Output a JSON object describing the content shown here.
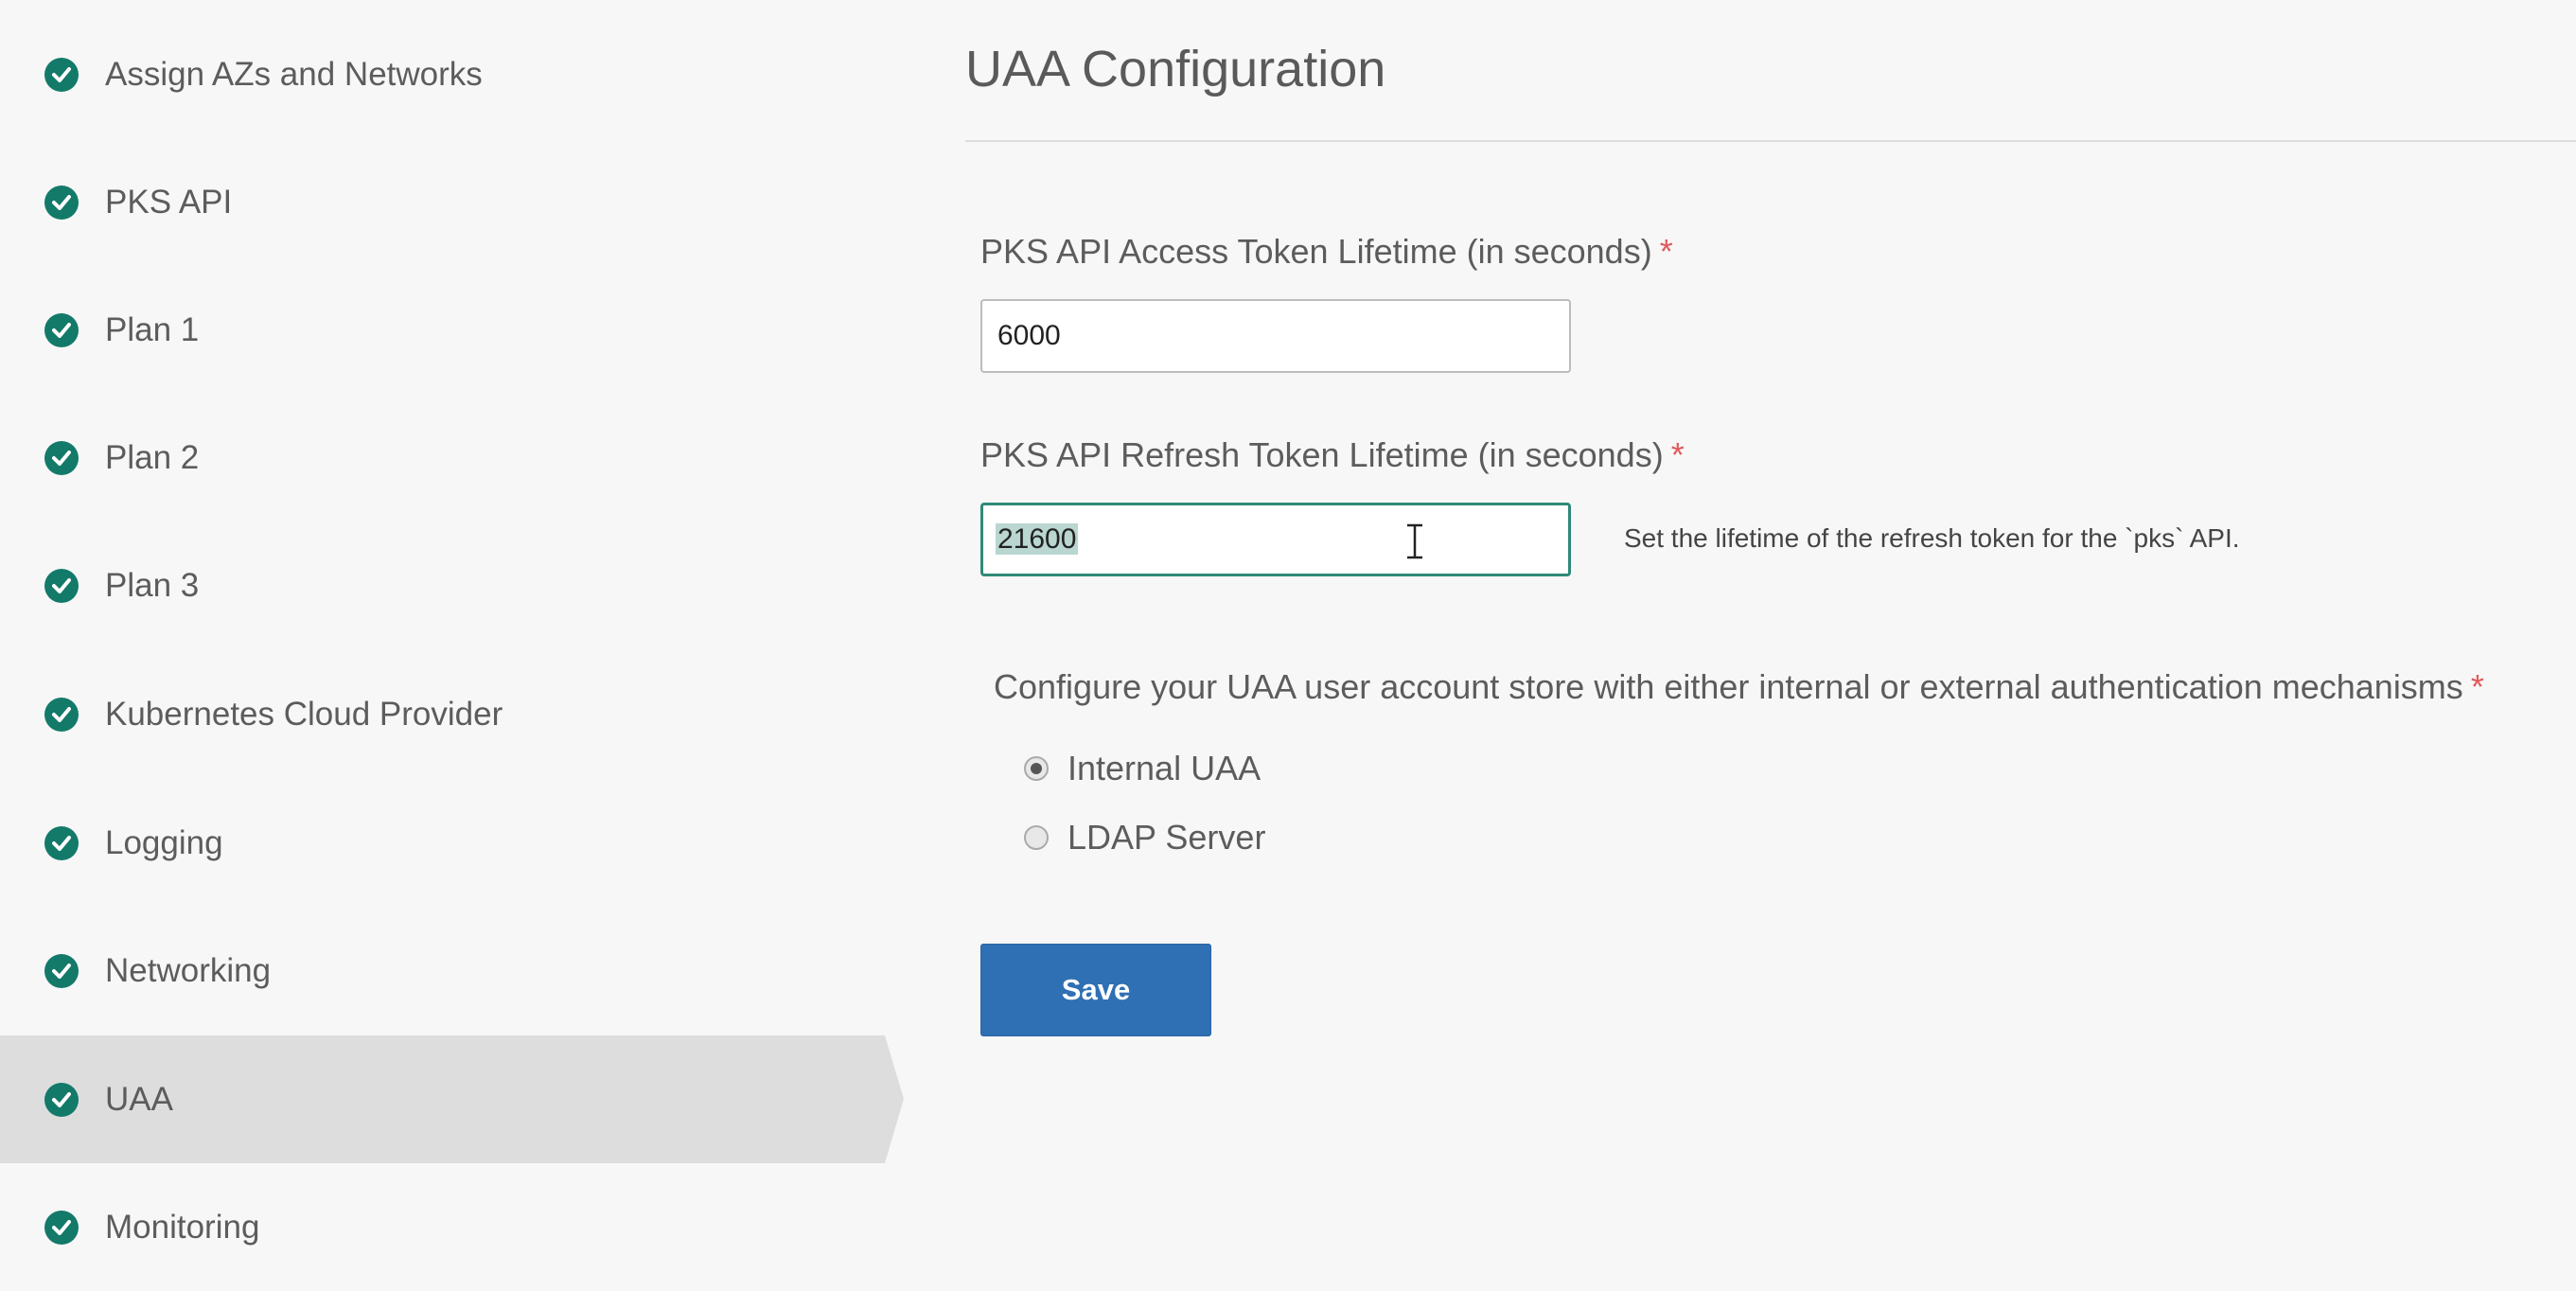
{
  "sidebar": {
    "items": [
      {
        "label": "Assign AZs and Networks",
        "status_icon": "check-circle-icon"
      },
      {
        "label": "PKS API",
        "status_icon": "check-circle-icon"
      },
      {
        "label": "Plan 1",
        "status_icon": "check-circle-icon"
      },
      {
        "label": "Plan 2",
        "status_icon": "check-circle-icon"
      },
      {
        "label": "Plan 3",
        "status_icon": "check-circle-icon"
      },
      {
        "label": "Kubernetes Cloud Provider",
        "status_icon": "check-circle-icon"
      },
      {
        "label": "Logging",
        "status_icon": "check-circle-icon"
      },
      {
        "label": "Networking",
        "status_icon": "check-circle-icon"
      },
      {
        "label": "UAA",
        "status_icon": "check-circle-icon",
        "active": true
      },
      {
        "label": "Monitoring",
        "status_icon": "check-circle-icon"
      }
    ]
  },
  "main": {
    "title": "UAA Configuration",
    "access_token": {
      "label": "PKS API Access Token Lifetime (in seconds)",
      "required_mark": "*",
      "value": "6000"
    },
    "refresh_token": {
      "label": "PKS API Refresh Token Lifetime (in seconds)",
      "required_mark": "*",
      "value": "21600",
      "help": "Set the lifetime of the refresh token for the `pks` API."
    },
    "account_store": {
      "label": "Configure your UAA user account store with either internal or external authentication mechanisms",
      "required_mark": "*",
      "options": [
        {
          "label": "Internal UAA",
          "selected": true
        },
        {
          "label": "LDAP Server",
          "selected": false
        }
      ]
    },
    "save_label": "Save"
  },
  "colors": {
    "check": "#137a6a",
    "save_button": "#2f6fb3",
    "focus_border": "#2e8a78",
    "required": "#e05a5a",
    "active_item": "#dddddd"
  }
}
